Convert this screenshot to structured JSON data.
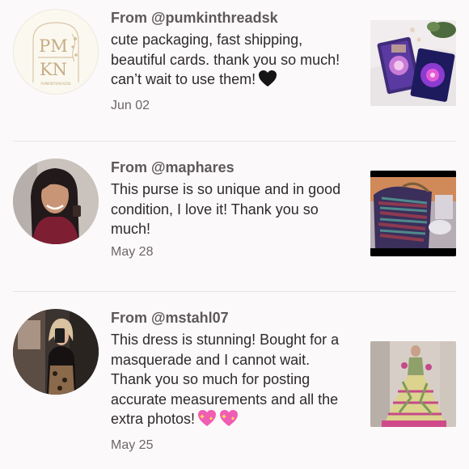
{
  "reviews": [
    {
      "from": "From @pumkinthreadsk",
      "text": "cute packaging, fast shipping, beautiful cards. thank you so much! can’t wait to use them!",
      "emoji": [
        "black-heart-icon"
      ],
      "date": "Jun 02",
      "avatar_logo": {
        "top": "PM",
        "bottom": "KN",
        "caption": "PUMKINTHREADSK"
      },
      "photo": "tarot-cards-photo"
    },
    {
      "from": "From @maphares",
      "text": "This purse is so unique and in good condition, I love it! Thank you so much!",
      "emoji": [],
      "date": "May 28",
      "avatar": "woman-long-dark-hair-photo",
      "photo": "purse-photo"
    },
    {
      "from": "From @mstahl07",
      "text": "This dress is stunning! Bought for a masquerade and I cannot wait. Thank you so much for posting accurate measurements and all the extra photos!",
      "emoji": [
        "sparkling-heart-icon",
        "sparkling-heart-icon"
      ],
      "date": "May 25",
      "avatar": "mirror-selfie-photo",
      "photo": "dress-photo"
    }
  ],
  "colors": {
    "background": "#fbf9fa",
    "handle": "#5f585b",
    "body_text": "#2f2a2c",
    "date": "#6d666a",
    "divider": "#e9e4e6",
    "sparkle_heart": "#f05db4"
  }
}
